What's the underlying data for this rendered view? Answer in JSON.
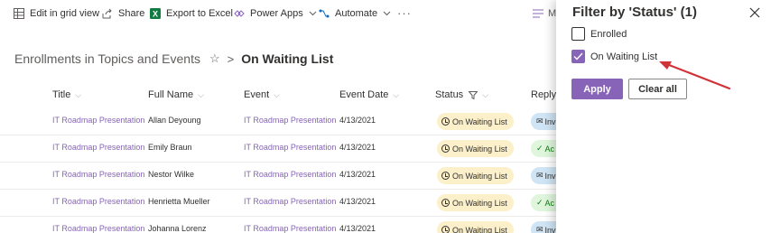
{
  "commandbar": {
    "edit_grid": "Edit in grid view",
    "share": "Share",
    "export_excel": "Export to Excel",
    "power_apps": "Power Apps",
    "automate": "Automate",
    "more": "···",
    "view_partial": "M"
  },
  "breadcrumb": {
    "parent": "Enrollments in Topics and Events",
    "star": "☆",
    "separator": ">",
    "current": "On Waiting List"
  },
  "columns": {
    "title": "Title",
    "full_name": "Full Name",
    "event": "Event",
    "event_date": "Event Date",
    "status": "Status",
    "reply": "Reply"
  },
  "rows": [
    {
      "title": "IT Roadmap Presentation",
      "full_name": "Allan Deyoung",
      "event": "IT Roadmap Presentation",
      "event_date": "4/13/2021",
      "status": "On Waiting List",
      "reply": "Inv"
    },
    {
      "title": "IT Roadmap Presentation",
      "full_name": "Emily Braun",
      "event": "IT Roadmap Presentation",
      "event_date": "4/13/2021",
      "status": "On Waiting List",
      "reply": "Ac"
    },
    {
      "title": "IT Roadmap Presentation",
      "full_name": "Nestor Wilke",
      "event": "IT Roadmap Presentation",
      "event_date": "4/13/2021",
      "status": "On Waiting List",
      "reply": "Inv"
    },
    {
      "title": "IT Roadmap Presentation",
      "full_name": "Henrietta Mueller",
      "event": "IT Roadmap Presentation",
      "event_date": "4/13/2021",
      "status": "On Waiting List",
      "reply": "Ac"
    },
    {
      "title": "IT Roadmap Presentation",
      "full_name": "Johanna Lorenz",
      "event": "IT Roadmap Presentation",
      "event_date": "4/13/2021",
      "status": "On Waiting List",
      "reply": "Inv"
    }
  ],
  "filter_panel": {
    "title": "Filter by 'Status' (1)",
    "options": [
      {
        "label": "Enrolled",
        "checked": false
      },
      {
        "label": "On Waiting List",
        "checked": true
      }
    ],
    "apply_label": "Apply",
    "clear_label": "Clear all"
  },
  "colors": {
    "accent": "#8764b8",
    "status_pill": "#fbf0c9",
    "reply_invited": "#cfe4f4",
    "reply_accepted": "#dff6dd",
    "annotation_arrow": "#d13438"
  },
  "icons": {
    "edit_grid": "grid-icon",
    "share": "share-icon",
    "export_excel": "excel-icon",
    "power_apps": "power-apps-icon",
    "automate": "automate-icon",
    "close": "close-icon"
  }
}
